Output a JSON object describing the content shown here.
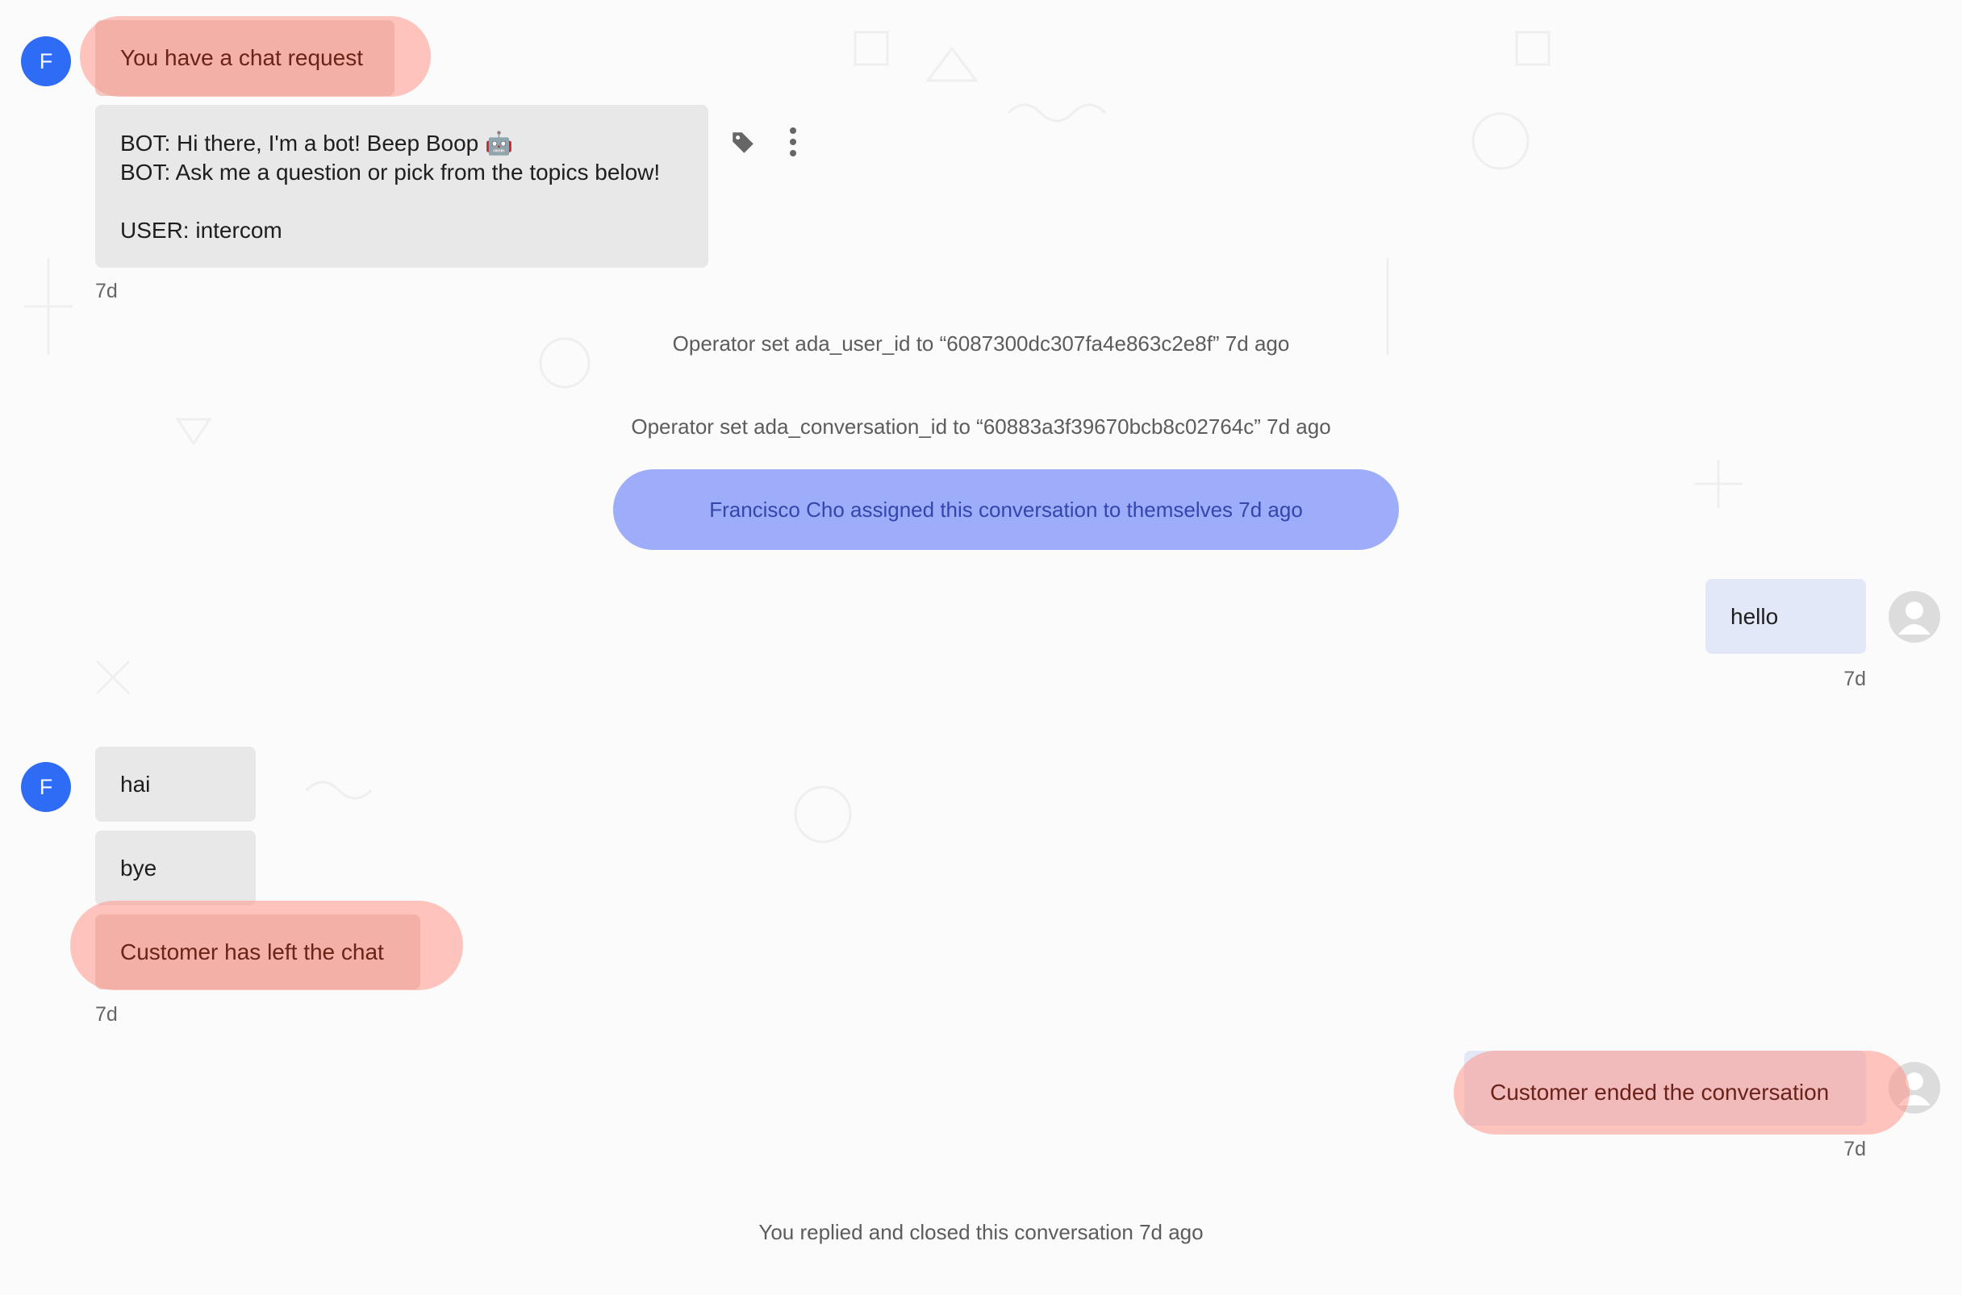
{
  "messages": {
    "chat_request": {
      "avatar": "F",
      "text": "You have a chat request"
    },
    "bot_transcript": {
      "lines": [
        "BOT: Hi there, I'm a bot! Beep Boop 🤖",
        "BOT: Ask me a question or pick from the topics below!",
        "USER: intercom"
      ],
      "time": "7d",
      "actions": [
        "tag-icon",
        "more-vertical-icon"
      ]
    },
    "event_user_id": "Operator set ada_user_id to “6087300dc307fa4e863c2e8f” 7d ago",
    "event_conversation_id": "Operator set ada_conversation_id to “60883a3f39670bcb8c02764c” 7d ago",
    "event_assigned": "Francisco Cho assigned this conversation to themselves 7d ago",
    "user_hello": {
      "text": "hello",
      "time": "7d"
    },
    "customer_group": {
      "avatar": "F",
      "items": [
        "hai",
        "bye",
        "Customer has left the chat"
      ],
      "time": "7d"
    },
    "customer_ended": {
      "text": "Customer ended the conversation",
      "time": "7d"
    },
    "event_closed": "You replied and closed this conversation 7d ago"
  },
  "colors": {
    "avatar": "#2f6cf5",
    "highlight_red": "#f4a79c",
    "highlight_blue": "#7f96fb",
    "user_bubble": "#e3e8f9",
    "bubble": "#e8e8e8"
  }
}
